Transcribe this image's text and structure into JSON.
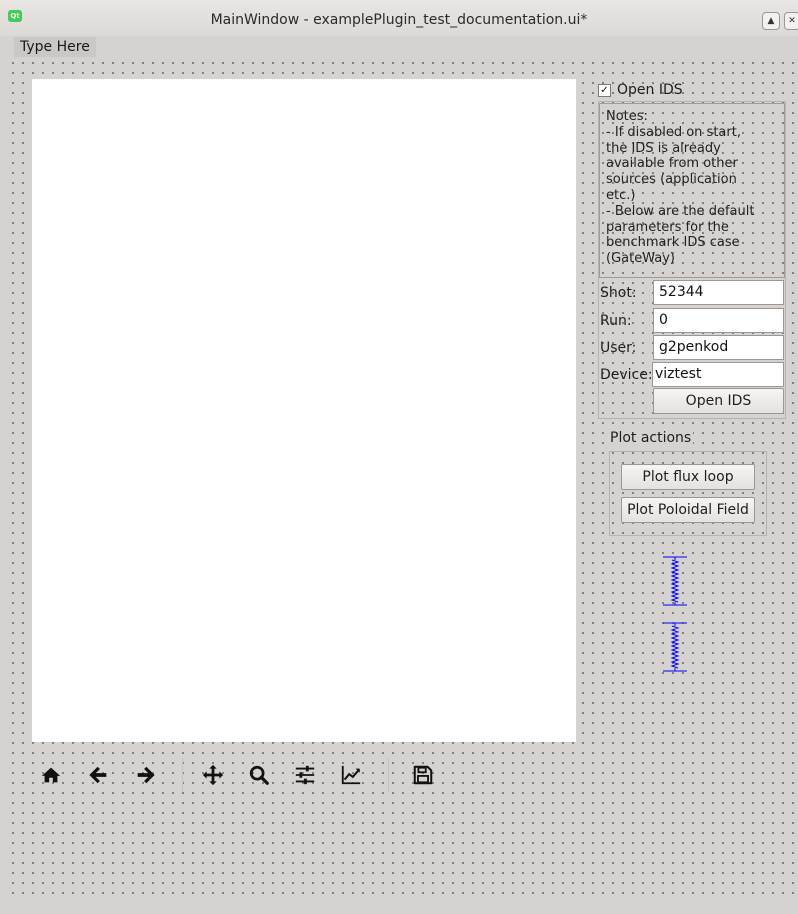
{
  "window": {
    "title": "MainWindow - examplePlugin_test_documentation.ui*",
    "app_icon": "qt-logo-icon",
    "app_icon_text": "Qt",
    "buttons": [
      "maximize-icon",
      "close-icon"
    ],
    "maximize_glyph": "▲",
    "close_glyph": "✕"
  },
  "menubar": {
    "items": [
      {
        "label": "Type Here"
      }
    ]
  },
  "toolbar": {
    "icons": [
      "home-icon",
      "back-arrow-icon",
      "forward-arrow-icon",
      "pan-icon",
      "zoom-icon",
      "configure-subplots-icon",
      "edit-axis-icon",
      "save-icon"
    ]
  },
  "ids_panel": {
    "checkbox": {
      "label": "Open IDS",
      "checked": true,
      "check_glyph": "✓"
    },
    "notes": [
      "Notes:",
      " - If disabled on start,",
      "the IDS is already",
      "available from other",
      "sources (application",
      "etc.)",
      " - Below are the default",
      "parameters for the",
      "benchmark IDS case",
      "(GateWay)"
    ],
    "fields": {
      "shot": {
        "label": "Shot:",
        "value": "52344"
      },
      "run": {
        "label": "Run:",
        "value": "0"
      },
      "user": {
        "label": "User:",
        "value": "g2penkod"
      },
      "device": {
        "label": "Device:",
        "value": "viztest"
      }
    },
    "open_button": "Open IDS"
  },
  "plot_actions": {
    "title": "Plot actions",
    "buttons": [
      "Plot flux loop",
      "Plot Poloidal Field"
    ]
  },
  "colors": {
    "background": "#d6d2d0",
    "canvas": "#ffffff",
    "spacer": "#0000ff"
  }
}
